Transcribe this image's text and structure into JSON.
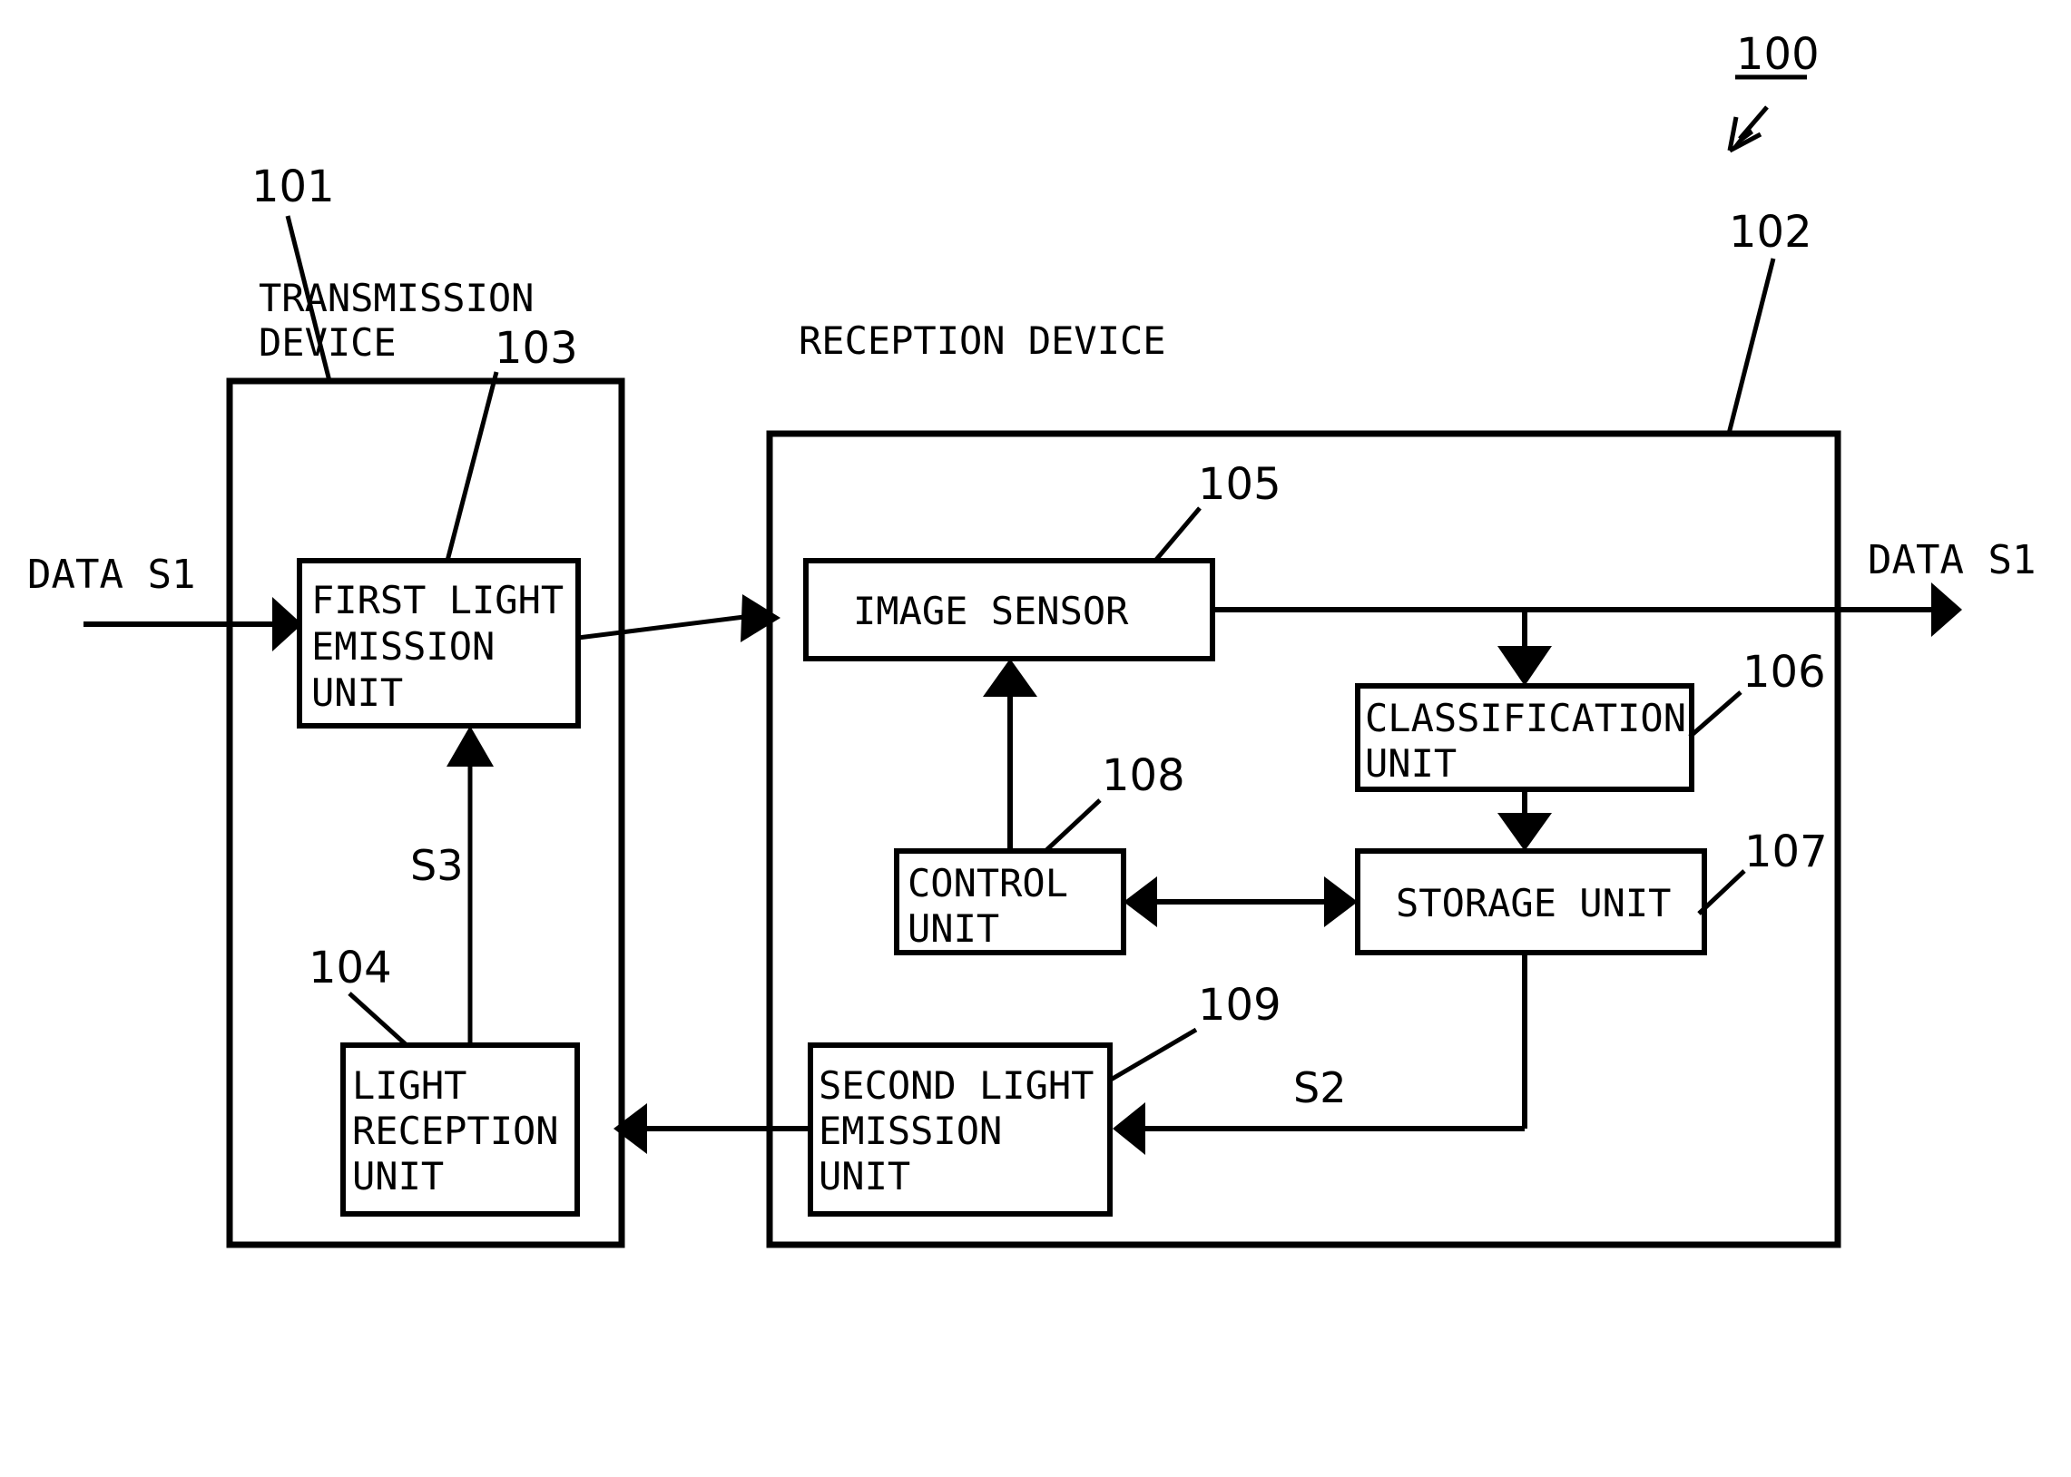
{
  "figure": {
    "system_label": "100",
    "io": {
      "input_label": "DATA S1",
      "output_label": "DATA S1"
    },
    "signals": {
      "s3": "S3",
      "s2": "S2"
    },
    "containers": [
      {
        "id": "transmission-device",
        "ref": "101",
        "title_line1": "TRANSMISSION",
        "title_line2": "DEVICE"
      },
      {
        "id": "reception-device",
        "ref": "102",
        "title_line1": "RECEPTION DEVICE",
        "title_line2": ""
      }
    ],
    "blocks": [
      {
        "id": "first-light-emission-unit",
        "ref": "103",
        "lines": [
          "FIRST LIGHT",
          "EMISSION",
          "UNIT"
        ]
      },
      {
        "id": "light-reception-unit",
        "ref": "104",
        "lines": [
          "LIGHT",
          "RECEPTION",
          "UNIT"
        ]
      },
      {
        "id": "image-sensor",
        "ref": "105",
        "lines": [
          "IMAGE SENSOR"
        ]
      },
      {
        "id": "classification-unit",
        "ref": "106",
        "lines": [
          "CLASSIFICATION",
          "UNIT"
        ]
      },
      {
        "id": "storage-unit",
        "ref": "107",
        "lines": [
          "STORAGE UNIT"
        ]
      },
      {
        "id": "control-unit",
        "ref": "108",
        "lines": [
          "CONTROL",
          "UNIT"
        ]
      },
      {
        "id": "second-light-emission-unit",
        "ref": "109",
        "lines": [
          "SECOND LIGHT",
          "EMISSION",
          "UNIT"
        ]
      }
    ],
    "colors": {
      "stroke": "#000000",
      "background": "#ffffff"
    }
  }
}
